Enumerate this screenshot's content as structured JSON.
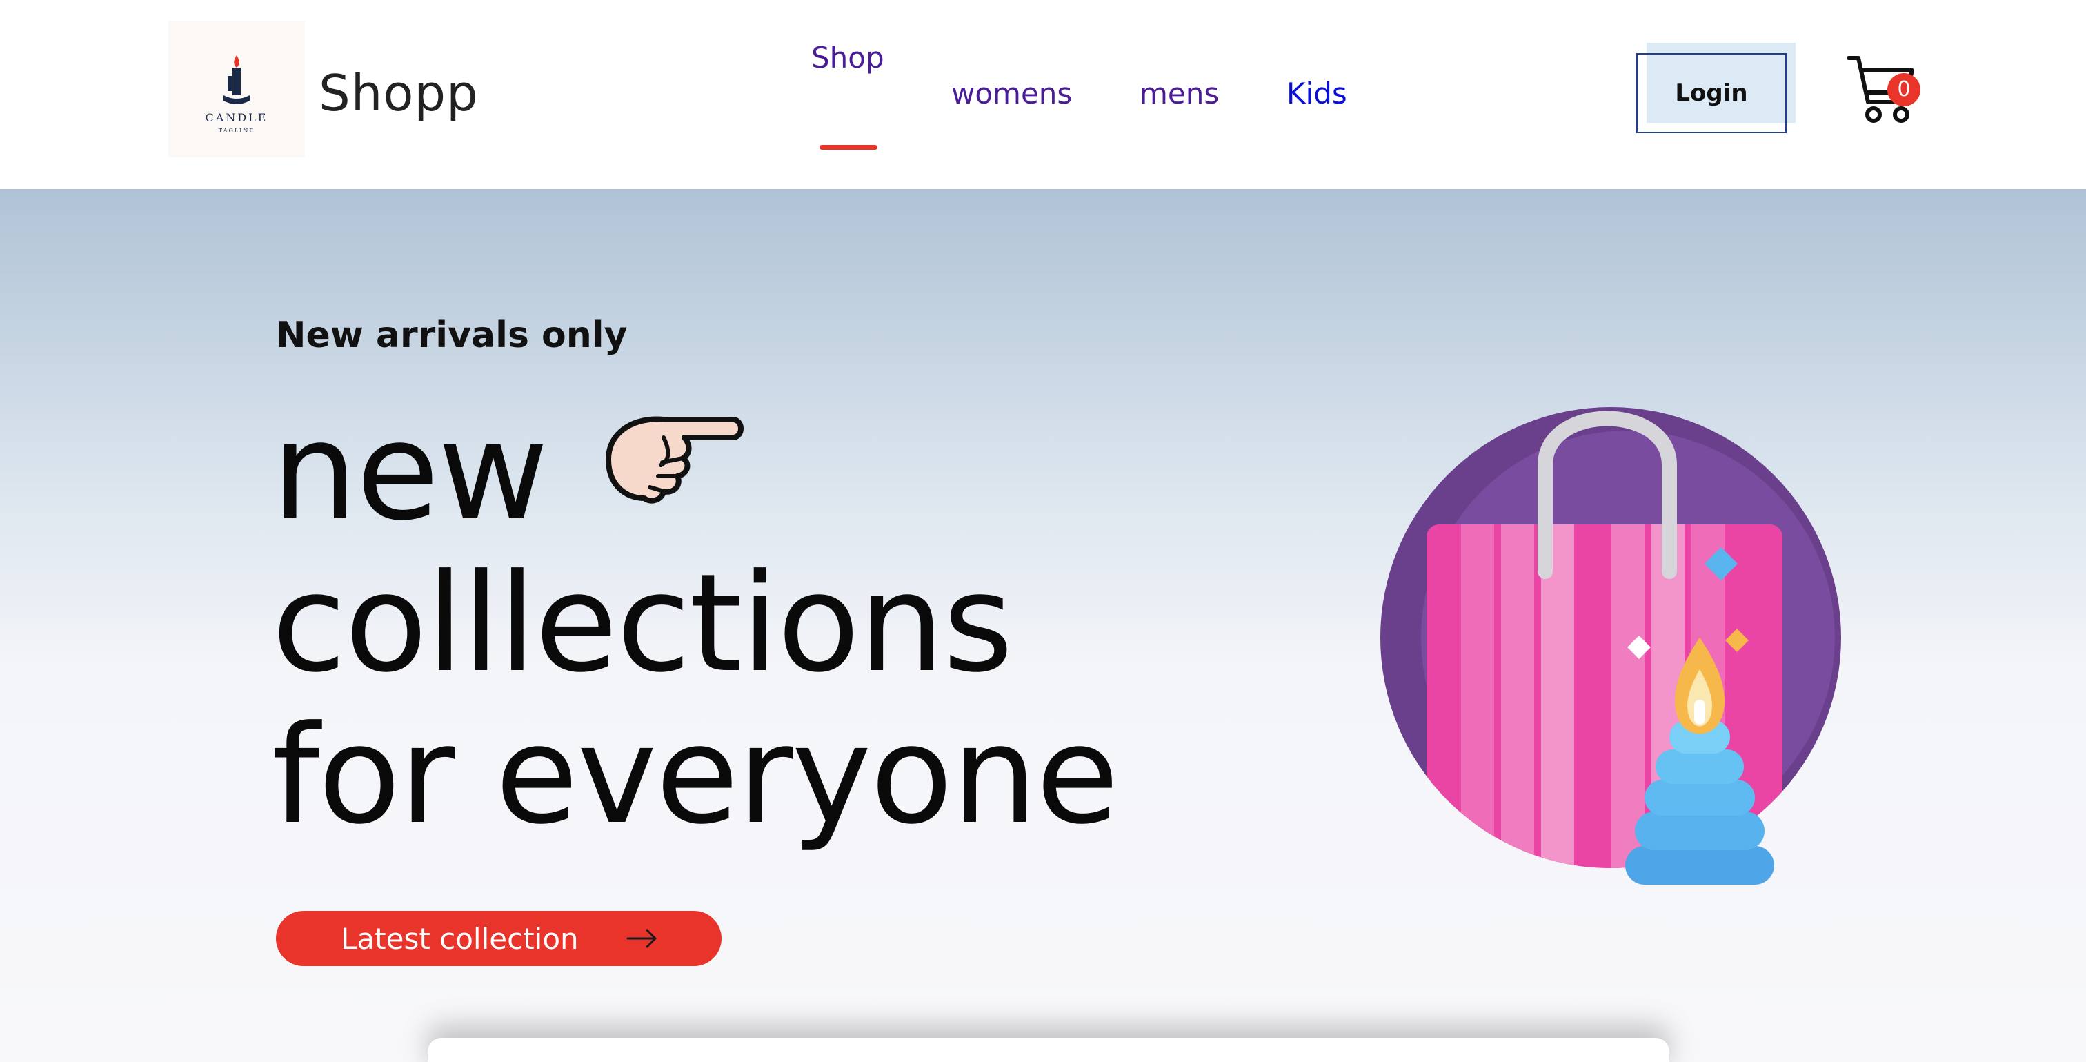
{
  "header": {
    "logo": {
      "name": "candle-logo",
      "mark_text": "CANDLE",
      "tagline": "TAGLINE"
    },
    "brand": "Shopp",
    "nav": [
      {
        "label": "Shop",
        "active": true
      },
      {
        "label": "womens",
        "active": false
      },
      {
        "label": "mens",
        "active": false
      },
      {
        "label": "Kids",
        "active": false
      }
    ],
    "login_label": "Login",
    "cart": {
      "icon": "cart-icon",
      "count": "0"
    }
  },
  "hero": {
    "kicker": "New arrivals only",
    "headline_line1": "new",
    "headline_line2": "colllections",
    "headline_line3": "for everyone",
    "pointer_icon": "pointing-hand-icon",
    "cta_label": "Latest collection",
    "cta_icon": "arrow-right-icon",
    "illustration": "shopping-bag-candle-illustration"
  },
  "colors": {
    "accent": "#e9342a",
    "nav_text": "#4a1c95",
    "nav_kids": "#0b10d6",
    "hero_gradient_top": "#b0c3d6",
    "hero_gradient_bottom": "#f8f8fb"
  }
}
